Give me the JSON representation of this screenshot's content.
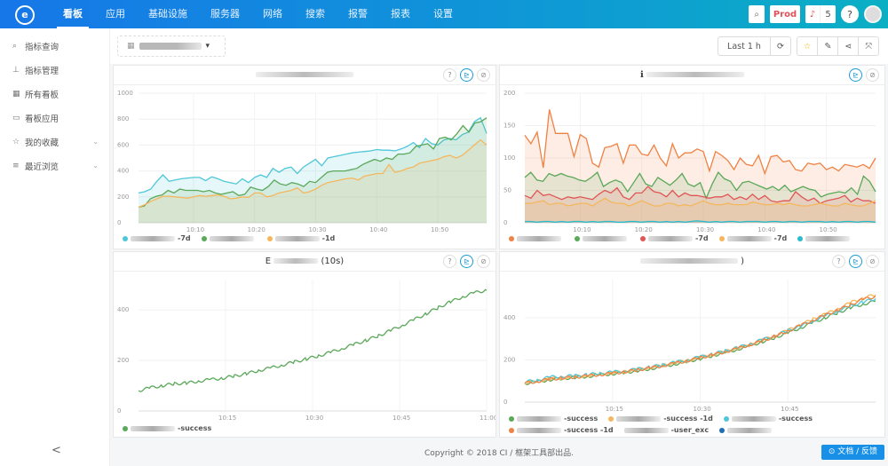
{
  "app": {
    "logo": "e"
  },
  "nav": {
    "items": [
      {
        "label": "看板",
        "active": true
      },
      {
        "label": "应用"
      },
      {
        "label": "基础设施"
      },
      {
        "label": "服务器"
      },
      {
        "label": "网络"
      },
      {
        "label": "搜索"
      },
      {
        "label": "报警"
      },
      {
        "label": "报表"
      },
      {
        "label": "设置"
      }
    ]
  },
  "topright": {
    "search_icon": "⌕",
    "env": "Prod",
    "bell_icon": "🔔",
    "notifications": "5",
    "help": "?"
  },
  "sidebar": {
    "items": [
      {
        "icon": "⌕",
        "label": "指标查询"
      },
      {
        "icon": "⊥",
        "label": "指标管理"
      },
      {
        "icon": "▦",
        "label": "所有看板"
      },
      {
        "icon": "▭",
        "label": "看板应用"
      },
      {
        "icon": "☆",
        "label": "我的收藏",
        "chevron": "⌄"
      },
      {
        "icon": "≡",
        "label": "最近浏览",
        "chevron": "⌄"
      }
    ],
    "collapse": "<"
  },
  "toolbar": {
    "dashboard_icon": "▦",
    "dropdown": "▾",
    "time_range": "Last 1 h",
    "refresh": "⟳",
    "star": "☆",
    "edit": "✎",
    "share": "⋖",
    "fullscreen": "⤧"
  },
  "panels": [
    {
      "title_suffix": "",
      "help": "?",
      "chart": "⊵",
      "link": "⊘"
    },
    {
      "title_prefix": "ℹ",
      "chart": "⊵",
      "link": "⊘"
    },
    {
      "title_prefix": "E",
      "title_suffix": "(10s)",
      "help": "?",
      "chart": "⊵",
      "link": "⊘"
    },
    {
      "title_suffix": ")",
      "help": "?",
      "chart": "⊵",
      "link": "⊘"
    }
  ],
  "chart_data": [
    {
      "type": "area",
      "title": "",
      "x": [
        "10:01",
        "10:02",
        "10:03",
        "10:04",
        "10:05",
        "10:06",
        "10:07",
        "10:08",
        "10:09",
        "10:10",
        "10:11",
        "10:12",
        "10:13",
        "10:14",
        "10:15",
        "10:16",
        "10:17",
        "10:18",
        "10:19",
        "10:20",
        "10:21",
        "10:22",
        "10:23",
        "10:24",
        "10:25",
        "10:26",
        "10:27",
        "10:28",
        "10:29",
        "10:30",
        "10:31",
        "10:32",
        "10:33",
        "10:34",
        "10:35",
        "10:36",
        "10:37",
        "10:38",
        "10:39",
        "10:40",
        "10:41",
        "10:42",
        "10:43",
        "10:44",
        "10:45",
        "10:46",
        "10:47",
        "10:48",
        "10:49",
        "10:50",
        "10:51",
        "10:52",
        "10:53",
        "10:54",
        "10:55",
        "10:56",
        "10:57",
        "10:58"
      ],
      "xticks": [
        "10:10",
        "10:20",
        "10:30",
        "10:40",
        "10:50"
      ],
      "yticks": [
        0,
        200,
        400,
        600,
        800,
        1000
      ],
      "ylim": [
        0,
        1000
      ],
      "series": [
        {
          "name": "-7d",
          "color": "#4ec7d8",
          "values": [
            230,
            240,
            260,
            320,
            370,
            320,
            330,
            340,
            345,
            350,
            350,
            325,
            355,
            340,
            320,
            310,
            300,
            340,
            310,
            350,
            370,
            350,
            420,
            390,
            420,
            430,
            380,
            430,
            460,
            490,
            440,
            500,
            510,
            520,
            530,
            540,
            545,
            550,
            555,
            565,
            560,
            560,
            555,
            570,
            590,
            620,
            580,
            650,
            610,
            600,
            640,
            650,
            640,
            680,
            700,
            780,
            810,
            690
          ]
        },
        {
          "name": "",
          "color": "#5aa85a",
          "values": [
            120,
            130,
            185,
            205,
            215,
            250,
            230,
            260,
            250,
            250,
            250,
            240,
            250,
            230,
            220,
            230,
            240,
            210,
            220,
            275,
            260,
            250,
            280,
            330,
            300,
            290,
            310,
            300,
            280,
            320,
            310,
            350,
            390,
            400,
            400,
            400,
            410,
            420,
            450,
            470,
            490,
            475,
            500,
            490,
            530,
            530,
            540,
            590,
            600,
            610,
            570,
            650,
            660,
            640,
            690,
            750,
            700,
            770,
            780,
            810
          ]
        },
        {
          "name": "-1d",
          "color": "#f5b75c",
          "values": [
            120,
            140,
            165,
            185,
            205,
            205,
            200,
            195,
            190,
            200,
            210,
            205,
            210,
            215,
            205,
            185,
            190,
            200,
            195,
            230,
            230,
            200,
            210,
            230,
            240,
            250,
            270,
            230,
            240,
            260,
            290,
            310,
            320,
            330,
            340,
            345,
            330,
            360,
            370,
            380,
            380,
            450,
            390,
            400,
            420,
            430,
            460,
            470,
            480,
            490,
            510,
            520,
            500,
            520,
            560,
            600,
            640,
            600
          ]
        }
      ]
    },
    {
      "type": "area",
      "title": "",
      "x": [
        "10:01",
        "10:02",
        "10:03",
        "10:04",
        "10:05",
        "10:06",
        "10:07",
        "10:08",
        "10:09",
        "10:10",
        "10:11",
        "10:12",
        "10:13",
        "10:14",
        "10:15",
        "10:16",
        "10:17",
        "10:18",
        "10:19",
        "10:20",
        "10:21",
        "10:22",
        "10:23",
        "10:24",
        "10:25",
        "10:26",
        "10:27",
        "10:28",
        "10:29",
        "10:30",
        "10:31",
        "10:32",
        "10:33",
        "10:34",
        "10:35",
        "10:36",
        "10:37",
        "10:38",
        "10:39",
        "10:40",
        "10:41",
        "10:42",
        "10:43",
        "10:44",
        "10:45",
        "10:46",
        "10:47",
        "10:48",
        "10:49",
        "10:50",
        "10:51",
        "10:52",
        "10:53",
        "10:54",
        "10:55",
        "10:56",
        "10:57",
        "10:58"
      ],
      "xticks": [
        "10:10",
        "10:20",
        "10:30",
        "10:40",
        "10:50"
      ],
      "yticks": [
        0,
        50,
        100,
        150,
        200
      ],
      "ylim": [
        0,
        200
      ],
      "series": [
        {
          "name": "",
          "color": "#ef8243",
          "values": [
            135,
            122,
            140,
            85,
            175,
            138,
            138,
            138,
            102,
            136,
            130,
            92,
            86,
            116,
            118,
            122,
            92,
            120,
            120,
            106,
            104,
            120,
            100,
            88,
            122,
            100,
            108,
            108,
            114,
            110,
            80,
            110,
            104,
            96,
            82,
            100,
            90,
            88,
            104,
            76,
            102,
            104,
            94,
            96,
            82,
            80,
            92,
            90,
            92,
            82,
            86,
            80,
            90,
            88,
            86,
            90,
            84,
            100
          ]
        },
        {
          "name": "",
          "color": "#5aa85a",
          "values": [
            70,
            78,
            66,
            64,
            76,
            72,
            76,
            72,
            70,
            66,
            64,
            70,
            78,
            56,
            62,
            66,
            62,
            48,
            62,
            76,
            60,
            56,
            70,
            64,
            58,
            66,
            76,
            60,
            56,
            62,
            38,
            60,
            78,
            68,
            64,
            50,
            62,
            64,
            60,
            56,
            52,
            56,
            50,
            58,
            48,
            52,
            56,
            52,
            50,
            40,
            44,
            46,
            48,
            46,
            54,
            44,
            72,
            64,
            48
          ]
        },
        {
          "name": "-7d",
          "color": "#e05555",
          "values": [
            42,
            38,
            50,
            42,
            44,
            40,
            36,
            40,
            38,
            40,
            38,
            36,
            44,
            50,
            46,
            54,
            40,
            36,
            46,
            46,
            56,
            48,
            46,
            40,
            50,
            40,
            46,
            42,
            42,
            40,
            38,
            40,
            40,
            44,
            36,
            40,
            36,
            44,
            36,
            42,
            34,
            32,
            34,
            34,
            48,
            40,
            34,
            38,
            30,
            34,
            36,
            38,
            42,
            32,
            38,
            34,
            34,
            30
          ]
        },
        {
          "name": "-7d",
          "color": "#f5b75c",
          "values": [
            30,
            30,
            32,
            34,
            28,
            30,
            30,
            26,
            28,
            30,
            30,
            26,
            32,
            38,
            32,
            30,
            30,
            26,
            30,
            34,
            30,
            26,
            26,
            30,
            30,
            26,
            28,
            26,
            30,
            34,
            30,
            28,
            28,
            30,
            28,
            28,
            28,
            32,
            30,
            28,
            28,
            30,
            28,
            30,
            28,
            26,
            26,
            28,
            30,
            28,
            26,
            26,
            30,
            28,
            26,
            26,
            30,
            34
          ]
        },
        {
          "name": "",
          "color": "#2bbcd0",
          "values": [
            2,
            2,
            1,
            2,
            2,
            1,
            2,
            1,
            2,
            2,
            1,
            2,
            1,
            2,
            2,
            1,
            1,
            2,
            2,
            1,
            2,
            2,
            1,
            2,
            1,
            2,
            1,
            2,
            3,
            2,
            1,
            2,
            1,
            2,
            2,
            1,
            2,
            2,
            2,
            1,
            2,
            2,
            1,
            2,
            2,
            1,
            2,
            2,
            2,
            1,
            2,
            1,
            2,
            2,
            1,
            2,
            2,
            1
          ]
        }
      ]
    },
    {
      "type": "line",
      "title": "(10s)",
      "x_range": [
        "10:00",
        "11:00"
      ],
      "xticks": [
        "10:15",
        "10:30",
        "10:45",
        "11:00"
      ],
      "yticks": [
        0,
        200,
        400
      ],
      "ylim": [
        0,
        520
      ],
      "series": [
        {
          "name": "-success",
          "color": "#5aa85a",
          "values": [
            80,
            92,
            100,
            108,
            110,
            118,
            124,
            130,
            138,
            148,
            160,
            170,
            182,
            194,
            206,
            218,
            232,
            248,
            264,
            280,
            298,
            318,
            340,
            362,
            386,
            410,
            432,
            452,
            468,
            478
          ]
        }
      ]
    },
    {
      "type": "line",
      "title": ")",
      "x_range": [
        "10:00",
        "11:00"
      ],
      "xticks": [
        "10:15",
        "10:30",
        "10:45"
      ],
      "yticks": [
        0,
        200,
        400
      ],
      "ylim": [
        0,
        580
      ],
      "series": [
        {
          "name": "-success",
          "color": "#5aa85a",
          "values": [
            88,
            96,
            106,
            112,
            116,
            122,
            128,
            134,
            140,
            148,
            158,
            168,
            180,
            192,
            206,
            220,
            234,
            250,
            268,
            286,
            306,
            328,
            352,
            376,
            400,
            424,
            446,
            464,
            478
          ]
        },
        {
          "name": "-success -1d",
          "color": "#f5b75c",
          "values": [
            92,
            100,
            110,
            116,
            120,
            126,
            132,
            138,
            146,
            154,
            164,
            174,
            186,
            198,
            212,
            226,
            240,
            256,
            274,
            294,
            316,
            340,
            366,
            392,
            416,
            442,
            470,
            494,
            508
          ]
        },
        {
          "name": "-success",
          "color": "#4ec7d8",
          "values": [
            96,
            104,
            118,
            122,
            124,
            130,
            136,
            142,
            148,
            156,
            166,
            176,
            188,
            200,
            214,
            228,
            242,
            258,
            276,
            296,
            316,
            338,
            360,
            384,
            408,
            432,
            454,
            474,
            490
          ]
        },
        {
          "name": "-success -1d",
          "color": "#ef8243",
          "values": [
            90,
            98,
            108,
            114,
            118,
            124,
            130,
            136,
            144,
            152,
            162,
            172,
            184,
            196,
            210,
            224,
            238,
            254,
            272,
            290,
            312,
            336,
            362,
            388,
            412,
            436,
            462,
            486,
            500
          ]
        },
        {
          "name": "-user_exc",
          "color": "#999999",
          "values": []
        },
        {
          "name": "",
          "color": "#1f6fb2",
          "values": []
        }
      ]
    }
  ],
  "footer": {
    "copyright": "Copyright © 2018 CI / 框架工具部出品.",
    "feedback": "⊙ 文档 / 反馈"
  }
}
